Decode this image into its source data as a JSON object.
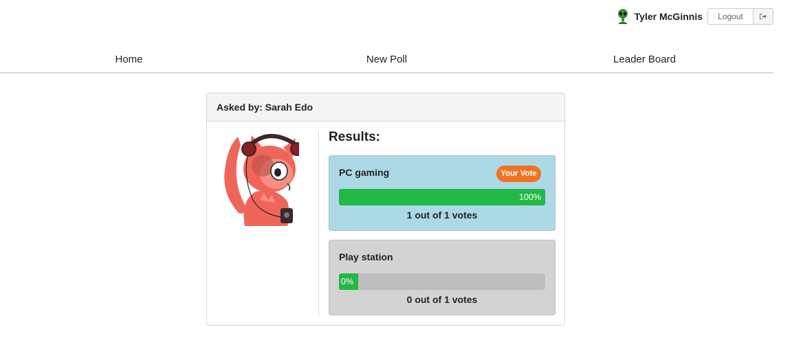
{
  "user": {
    "name": "Tyler McGinnis",
    "logout_label": "Logout"
  },
  "nav": {
    "home": "Home",
    "new_poll": "New Poll",
    "leader_board": "Leader Board"
  },
  "poll": {
    "asked_by": "Asked by: Sarah Edo",
    "results_title": "Results:",
    "options": [
      {
        "text": "PC gaming",
        "badge": "Your Vote",
        "percent": 100,
        "percent_label": "100%",
        "votes_label": "1 out of 1 votes"
      },
      {
        "text": "Play station",
        "percent": 0,
        "percent_label": "0%",
        "votes_label": "0 out of 1 votes"
      }
    ]
  },
  "colors": {
    "voted_option_bg": "#add8e6",
    "other_option_bg": "#d3d3d3",
    "progress_fill": "#22b845",
    "badge": "#f0731f"
  },
  "icons": {
    "user_avatar": "alien-avatar-icon",
    "logout": "sign-out-icon",
    "author": "cat-with-headphones-avatar"
  }
}
